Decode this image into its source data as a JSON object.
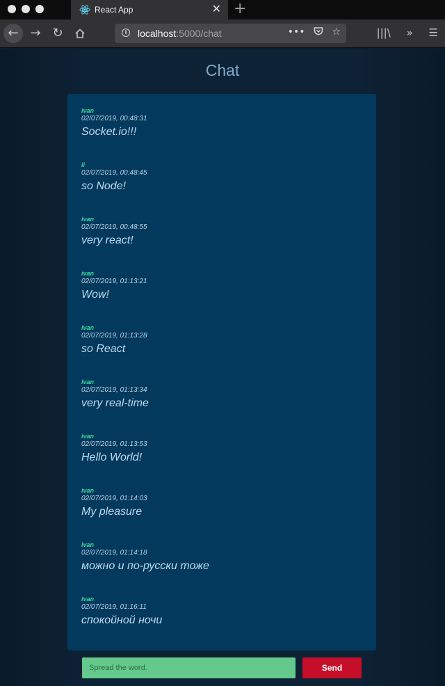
{
  "browser": {
    "tab_title": "React App",
    "new_tab_symbol": "+",
    "close_symbol": "✕",
    "url_host": "localhost",
    "url_path": ":5000/chat",
    "accent_colors": {
      "chrome_dark": "#0c0c0d",
      "toolbar": "#323234",
      "urlbar": "#474749"
    }
  },
  "page": {
    "title": "Chat",
    "colors": {
      "chat_bg": "#03395c",
      "username": "#3fd9a0",
      "send": "#c50f2a",
      "input": "#64c98a"
    }
  },
  "messages": [
    {
      "user": "ivan",
      "time": "02/07/2019, 00:48:31",
      "text": "Socket.io!!!"
    },
    {
      "user": "ii",
      "time": "02/07/2019, 00:48:45",
      "text": "so Node!"
    },
    {
      "user": "ivan",
      "time": "02/07/2019, 00:48:55",
      "text": "very react!"
    },
    {
      "user": "ivan",
      "time": "02/07/2019, 01:13:21",
      "text": "Wow!"
    },
    {
      "user": "ivan",
      "time": "02/07/2019, 01:13:28",
      "text": "so React"
    },
    {
      "user": "ivan",
      "time": "02/07/2019, 01:13:34",
      "text": "very real-time"
    },
    {
      "user": "ivan",
      "time": "02/07/2019, 01:13:53",
      "text": "Hello World!"
    },
    {
      "user": "ivan",
      "time": "02/07/2019, 01:14:03",
      "text": "My pleasure"
    },
    {
      "user": "ivan",
      "time": "02/07/2019, 01:14:18",
      "text": "можно и по-русски тоже"
    },
    {
      "user": "ivan",
      "time": "02/07/2019, 01:16:11",
      "text": "спокойной ночи"
    }
  ],
  "composer": {
    "placeholder": "Spread the word.",
    "value": "",
    "send_label": "Send"
  }
}
